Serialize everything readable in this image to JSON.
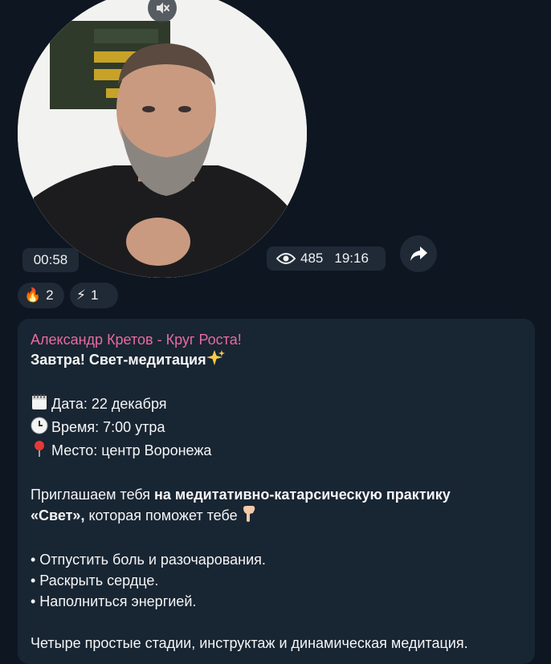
{
  "video": {
    "duration": "00:58",
    "views": "485",
    "time": "19:16"
  },
  "reactions": [
    {
      "emoji": "🔥",
      "count": "2"
    },
    {
      "emoji": "⚡",
      "count": "1"
    }
  ],
  "message": {
    "sender": "Александр Кретов - Круг Роста!",
    "title": "Завтра! Свет-медитация",
    "date_line": "Дата: 22 декабря",
    "time_line": "Время: 7:00 утра",
    "place_line": "Место: центр Воронежа",
    "invite_start": "Приглашаем тебя ",
    "invite_bold_1": "на медитативно-катарсическую практику",
    "invite_bold_2": "«Свет»,",
    "invite_end": " которая поможет тебе",
    "bullet_1": "• Отпустить боль и разочарования.",
    "bullet_2": "• Раскрыть сердце.",
    "bullet_3": "• Наполниться энергией.",
    "closing": "Четыре простые стадии, инструктаж и динамическая медитация."
  },
  "colors": {
    "background": "#0e1621",
    "bubble": "#182533",
    "sender": "#e86aa0",
    "pill": "#1f2a36"
  },
  "icons": [
    "mute-icon",
    "eye-icon",
    "share-icon",
    "calendar-icon",
    "clock-icon",
    "pin-icon",
    "sparkles-icon",
    "pointing-down-icon"
  ]
}
